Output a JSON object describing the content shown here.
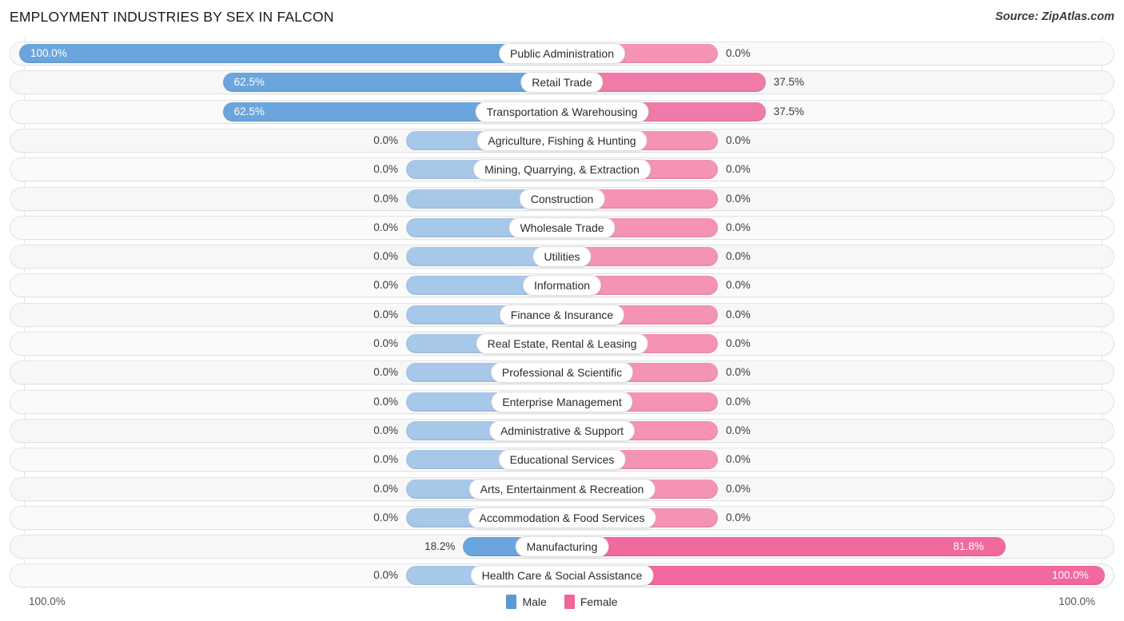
{
  "header": {
    "title": "EMPLOYMENT INDUSTRIES BY SEX IN FALCON",
    "source": "Source: ZipAtlas.com"
  },
  "footer": {
    "axis_left": "100.0%",
    "axis_right": "100.0%",
    "legend": [
      {
        "label": "Male",
        "color": "#5b9bd5"
      },
      {
        "label": "Female",
        "color": "#f2639a"
      }
    ]
  },
  "colors": {
    "male": "#6ba5dd",
    "male_zero": "#a8c8ea",
    "female": "#f2699e",
    "female_zero": "#f593b5",
    "track": "#fafafa",
    "gridline": "#e6e6e6"
  },
  "chart_data": {
    "type": "bar",
    "orientation": "horizontal-diverging",
    "title": "EMPLOYMENT INDUSTRIES BY SEX IN FALCON",
    "subtitle": "",
    "xlabel": "",
    "ylabel": "",
    "xlim": [
      100,
      100
    ],
    "grid": true,
    "legend_position": "bottom-center",
    "axis_labels": {
      "left": "100.0%",
      "right": "100.0%"
    },
    "categories": [
      "Public Administration",
      "Retail Trade",
      "Transportation & Warehousing",
      "Agriculture, Fishing & Hunting",
      "Mining, Quarrying, & Extraction",
      "Construction",
      "Wholesale Trade",
      "Utilities",
      "Information",
      "Finance & Insurance",
      "Real Estate, Rental & Leasing",
      "Professional & Scientific",
      "Enterprise Management",
      "Administrative & Support",
      "Educational Services",
      "Arts, Entertainment & Recreation",
      "Accommodation & Food Services",
      "Manufacturing",
      "Health Care & Social Assistance"
    ],
    "series": [
      {
        "name": "Male",
        "color": "#5b9bd5",
        "values": [
          100.0,
          62.5,
          62.5,
          0.0,
          0.0,
          0.0,
          0.0,
          0.0,
          0.0,
          0.0,
          0.0,
          0.0,
          0.0,
          0.0,
          0.0,
          0.0,
          0.0,
          18.2,
          0.0
        ],
        "labels": [
          "100.0%",
          "62.5%",
          "62.5%",
          "0.0%",
          "0.0%",
          "0.0%",
          "0.0%",
          "0.0%",
          "0.0%",
          "0.0%",
          "0.0%",
          "0.0%",
          "0.0%",
          "0.0%",
          "0.0%",
          "0.0%",
          "0.0%",
          "18.2%",
          "0.0%"
        ]
      },
      {
        "name": "Female",
        "color": "#f2639a",
        "values": [
          0.0,
          37.5,
          37.5,
          0.0,
          0.0,
          0.0,
          0.0,
          0.0,
          0.0,
          0.0,
          0.0,
          0.0,
          0.0,
          0.0,
          0.0,
          0.0,
          0.0,
          81.8,
          100.0
        ],
        "labels": [
          "0.0%",
          "37.5%",
          "37.5%",
          "0.0%",
          "0.0%",
          "0.0%",
          "0.0%",
          "0.0%",
          "0.0%",
          "0.0%",
          "0.0%",
          "0.0%",
          "0.0%",
          "0.0%",
          "0.0%",
          "0.0%",
          "0.0%",
          "81.8%",
          "100.0%"
        ]
      }
    ]
  }
}
